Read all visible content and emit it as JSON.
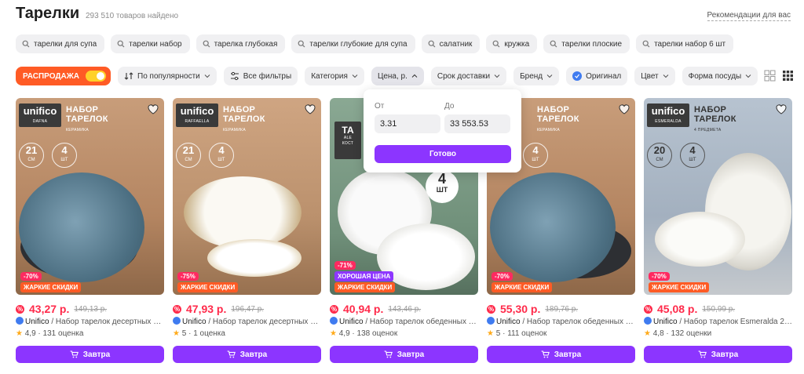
{
  "header": {
    "title": "Тарелки",
    "count": "293 510 товаров найдено",
    "recommendations": "Рекомендации для вас"
  },
  "suggestions": [
    "тарелки для супа",
    "тарелки набор",
    "тарелка глубокая",
    "тарелки глубокие для супа",
    "салатник",
    "кружка",
    "тарелки плоские",
    "тарелки набор 6 шт"
  ],
  "filters": {
    "sale": "РАСПРОДАЖА",
    "sort": "По популярности",
    "all_filters": "Все фильтры",
    "category": "Категория",
    "price": "Цена, р.",
    "delivery": "Срок доставки",
    "brand": "Бренд",
    "original": "Оригинал",
    "color": "Цвет",
    "shape": "Форма посуды"
  },
  "price_popup": {
    "from_label": "От",
    "to_label": "До",
    "from_value": "3.31",
    "to_value": "33 553.53",
    "done": "Готово"
  },
  "products": [
    {
      "image_brand": "unifico",
      "image_sub": "DAFNA",
      "image_title_1": "НАБОР",
      "image_title_2": "ТАРЕЛОК",
      "image_material": "КЕРАМИКА",
      "size_num": "21",
      "size_unit": "СМ",
      "qty_num": "4",
      "qty_unit": "ШТ",
      "discount": "-70%",
      "badge": "ЖАРКИЕ СКИДКИ",
      "price": "43,27 р.",
      "old_price": "149,13 р.",
      "brand": "Unifico",
      "title": " / Набор тарелок десертных Dafna",
      "rating": "4,9",
      "reviews": "131 оценка",
      "cart": "Завтра",
      "bg": "#b98a66",
      "plate": "#5d7f92"
    },
    {
      "image_brand": "unifico",
      "image_sub": "RAFFAELLA",
      "image_title_1": "НАБОР",
      "image_title_2": "ТАРЕЛОК",
      "image_material": "КЕРАМИКА",
      "size_num": "21",
      "size_unit": "СМ",
      "qty_num": "4",
      "qty_unit": "ШТ",
      "discount": "-75%",
      "badge": "ЖАРКИЕ СКИДКИ",
      "price": "47,93 р.",
      "old_price": "196,47 р.",
      "brand": "Unifico",
      "title": " / Набор тарелок десертных керамических",
      "rating": "5",
      "reviews": "1 оценка",
      "cart": "Завтра",
      "bg": "#c39a78",
      "plate": "#f3efe6"
    },
    {
      "image_brand": "",
      "image_sub": "",
      "image_title_1": "ТА",
      "image_title_2": "ALE",
      "image_material": "КОСТ",
      "size_num": "",
      "size_unit": "",
      "qty_num": "4",
      "qty_unit": "ШТ",
      "discount": "-71%",
      "badge": "ХОРОШАЯ ЦЕНА",
      "price": "40,94 р.",
      "old_price": "143,46 р.",
      "brand": "Unifico",
      "title": " / Набор тарелок обеденных Alessandra",
      "rating": "4,9",
      "reviews": "138 оценок",
      "cart": "Завтра",
      "bg": "#7d9c86",
      "plate": "#f4f4f2"
    },
    {
      "image_brand": "unifico",
      "image_sub": "",
      "image_title_1": "НАБОР",
      "image_title_2": "ТАРЕЛОК",
      "image_material": "КЕРАМИКА",
      "size_num": "",
      "size_unit": "",
      "qty_num": "4",
      "qty_unit": "ШТ",
      "discount": "-70%",
      "badge": "ЖАРКИЕ СКИДКИ",
      "price": "55,30 р.",
      "old_price": "189,76 р.",
      "brand": "Unifico",
      "title": " / Набор тарелок обеденных 27 см",
      "rating": "5",
      "reviews": "111 оценок",
      "cart": "Завтра",
      "bg": "#b98a66",
      "plate": "#5d7f92"
    },
    {
      "image_brand": "unifico",
      "image_sub": "ESMERALDA",
      "image_title_1": "НАБОР",
      "image_title_2": "ТАРЕЛОК",
      "image_material": "4 ПРЕДМЕТА",
      "size_num": "20",
      "size_unit": "СМ",
      "qty_num": "4",
      "qty_unit": "ШТ",
      "discount": "-70%",
      "badge": "ЖАРКИЕ СКИДКИ",
      "price": "45,08 р.",
      "old_price": "150,99 р.",
      "brand": "Unifico",
      "title": " / Набор тарелок Esmeralda 20 см",
      "rating": "4,8",
      "reviews": "132 оценки",
      "cart": "Завтра",
      "bg": "#aab6c4",
      "plate": "#eceae3"
    }
  ]
}
